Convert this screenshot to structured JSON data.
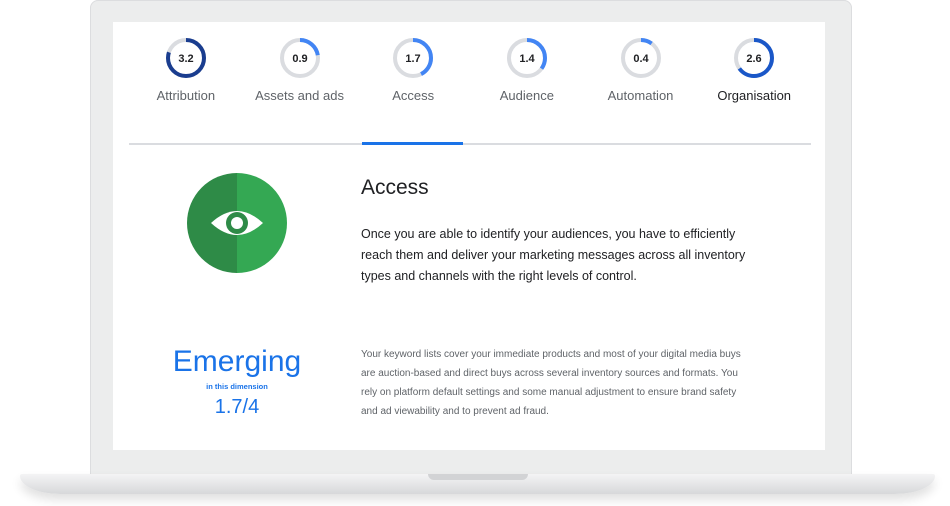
{
  "tabs": [
    {
      "label": "Attribution",
      "value": "3.2",
      "score": 3.2,
      "active": false
    },
    {
      "label": "Assets and ads",
      "value": "0.9",
      "score": 0.9,
      "active": false
    },
    {
      "label": "Access",
      "value": "1.7",
      "score": 1.7,
      "active": true
    },
    {
      "label": "Audience",
      "value": "1.4",
      "score": 1.4,
      "active": false
    },
    {
      "label": "Automation",
      "value": "0.4",
      "score": 0.4,
      "active": false
    },
    {
      "label": "Organisation",
      "value": "2.6",
      "score": 2.6,
      "active": false
    }
  ],
  "gauge_max": 4,
  "colors": {
    "gauge_dark": "#1a3d8f",
    "gauge_mid": "#1a57c8",
    "gauge_light": "#4285f4",
    "gauge_track": "#dadce0",
    "accent": "#1a73e8",
    "green_dark": "#2e8b47",
    "green_light": "#34a853"
  },
  "section": {
    "icon": "eye-icon",
    "title": "Access",
    "description": "Once you are able to identify your audiences, you have to efficiently reach them and deliver your marketing messages across all inventory types and channels with the right levels of control."
  },
  "level": {
    "name": "Emerging",
    "subtitle": "in this dimension",
    "score": "1.7/4",
    "description": "Your keyword lists cover your immediate products and most of your digital media buys are auction-based and direct buys across several inventory sources and formats. You rely on platform default settings and some manual adjustment to ensure brand safety and ad viewability and to prevent ad fraud."
  }
}
